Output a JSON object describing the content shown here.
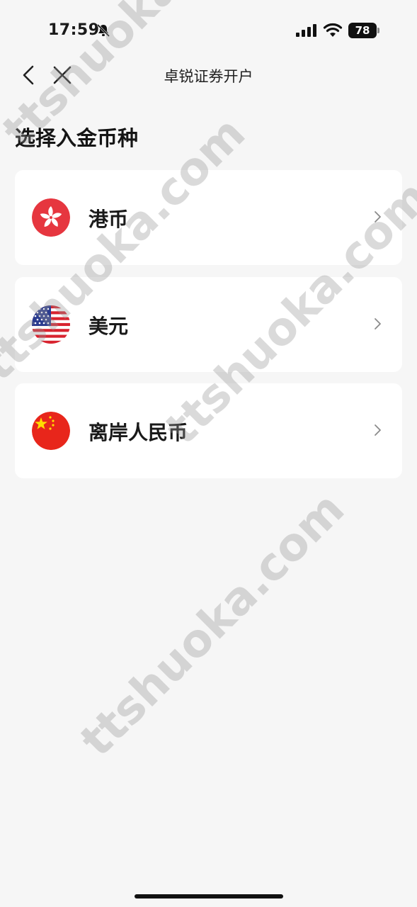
{
  "status_bar": {
    "time": "17:59",
    "battery": "78"
  },
  "nav": {
    "title": "卓锐证券开户",
    "icons": [
      "back-chevron-icon",
      "close-icon"
    ]
  },
  "section_title": "选择入金币种",
  "currencies": [
    {
      "label": "港币",
      "flag": "hong-kong-flag-icon"
    },
    {
      "label": "美元",
      "flag": "us-flag-icon"
    },
    {
      "label": "离岸人民币",
      "flag": "china-flag-icon"
    }
  ],
  "watermark": "ttshuoka.com",
  "colors": {
    "background": "#f6f6f6",
    "card": "#ffffff",
    "hk_red": "#e6363f",
    "cn_red": "#e8261b",
    "star_yellow": "#ffde00"
  }
}
